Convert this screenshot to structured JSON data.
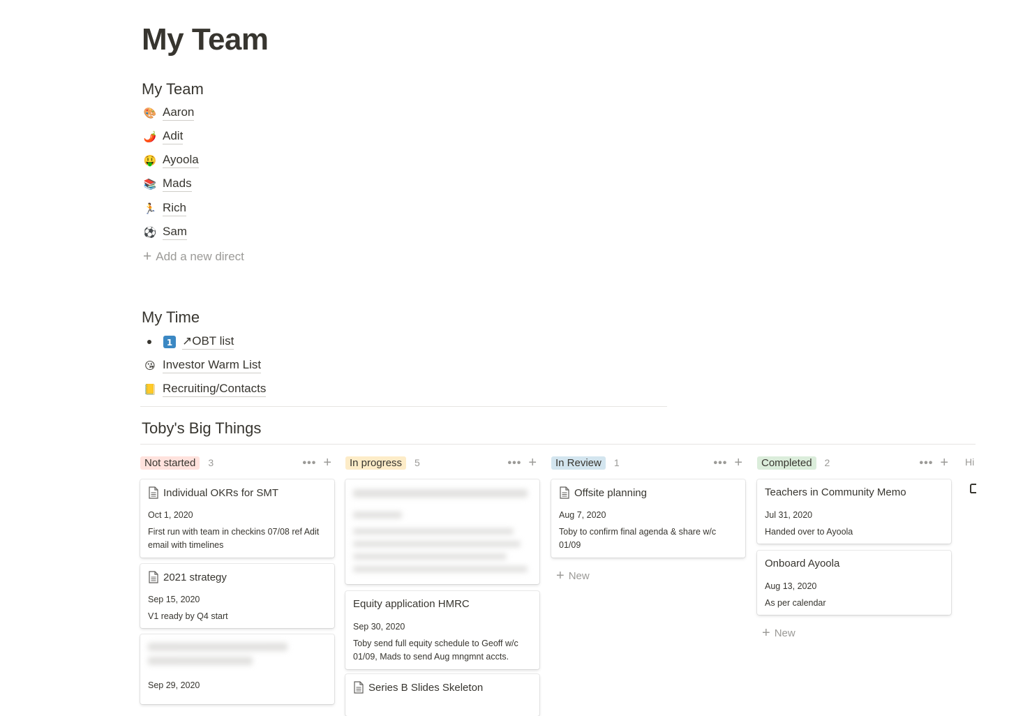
{
  "page": {
    "title": "My Team"
  },
  "team_section": {
    "heading": "My Team",
    "members": [
      {
        "label": "Aaron",
        "icon": "🎨"
      },
      {
        "label": "Adit",
        "icon": "🌶️"
      },
      {
        "label": "Ayoola",
        "icon": "🤑"
      },
      {
        "label": "Mads",
        "icon": "📚"
      },
      {
        "label": "Rich",
        "icon": "🏃"
      },
      {
        "label": "Sam",
        "icon": "⚽"
      }
    ],
    "add_label": "Add a new direct"
  },
  "time_section": {
    "heading": "My Time",
    "links": [
      {
        "label": "OBT list",
        "icon": "1️⃣",
        "prefix": "↗"
      },
      {
        "label": "Investor Warm List",
        "icon": "😘"
      },
      {
        "label": "Recruiting/Contacts",
        "icon": "📒"
      }
    ]
  },
  "board": {
    "heading": "Toby's Big Things",
    "hidden_label": "Hi",
    "new_label": "New",
    "columns": [
      {
        "status": "Not started",
        "count": "3",
        "color": "#ffe2dd",
        "cards": [
          {
            "title": "Individual OKRs for SMT",
            "date": "Oct 1, 2020",
            "note": "First run with team in checkins 07/08 ref Adit email with timelines"
          },
          {
            "title": "2021 strategy",
            "date": "Sep 15, 2020",
            "note": "V1 ready by Q4 start"
          },
          {
            "title": "",
            "date": "Sep 29, 2020",
            "note": ""
          }
        ]
      },
      {
        "status": "In progress",
        "count": "5",
        "color": "#fdecc8",
        "cards": [
          {
            "title": "",
            "date": "",
            "note": ""
          },
          {
            "title": "Equity application HMRC",
            "date": "Sep 30, 2020",
            "note": "Toby send full equity schedule to Geoff w/c 01/09, Mads to send Aug mngmnt accts."
          },
          {
            "title": "Series B Slides Skeleton",
            "date": "",
            "note": ""
          }
        ]
      },
      {
        "status": "In Review",
        "count": "1",
        "color": "#d3e5ef",
        "cards": [
          {
            "title": "Offsite planning",
            "date": "Aug 7, 2020",
            "note": "Toby to confirm final agenda & share w/c 01/09"
          }
        ]
      },
      {
        "status": "Completed",
        "count": "2",
        "color": "#dbeddb",
        "cards": [
          {
            "title": "Teachers in Community Memo",
            "date": "Jul 31, 2020",
            "note": "Handed over to Ayoola"
          },
          {
            "title": "Onboard Ayoola",
            "date": "Aug 13, 2020",
            "note": "As per calendar"
          }
        ]
      }
    ]
  }
}
